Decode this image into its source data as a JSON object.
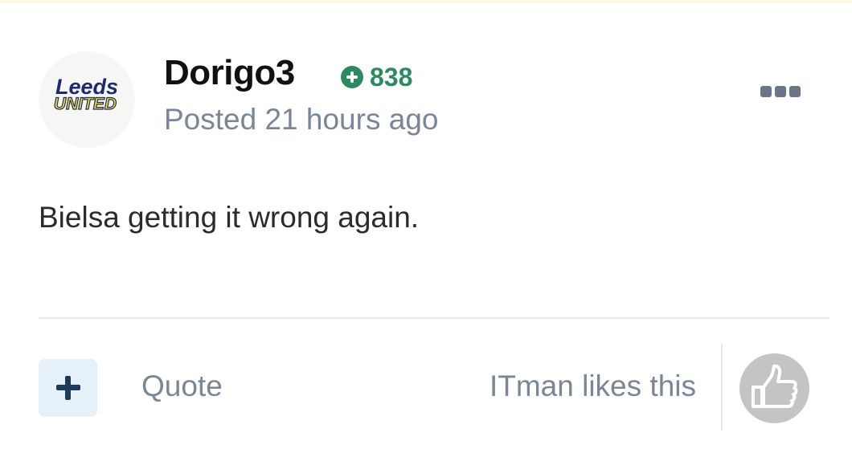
{
  "post": {
    "author": {
      "name": "Dorigo3",
      "avatar_alt": "Leeds United",
      "avatar_line1": "Leeds",
      "avatar_line2": "UNITED",
      "reputation_icon": "plus-circle-icon",
      "reputation": "838"
    },
    "posted": "Posted 21 hours ago",
    "more_menu_icon": "ellipsis-icon",
    "content": "Bielsa getting it wrong again."
  },
  "footer": {
    "react_icon": "plus-icon",
    "quote_label": "Quote",
    "likes_text": "ITman likes this",
    "like_icon": "thumbs-up-icon"
  },
  "colors": {
    "reputation_green": "#2d8a5f",
    "muted_text": "#7a8598",
    "react_bg": "#e6f0f8",
    "react_plus": "#1d3a5a",
    "like_bg": "#c4c4c4"
  }
}
